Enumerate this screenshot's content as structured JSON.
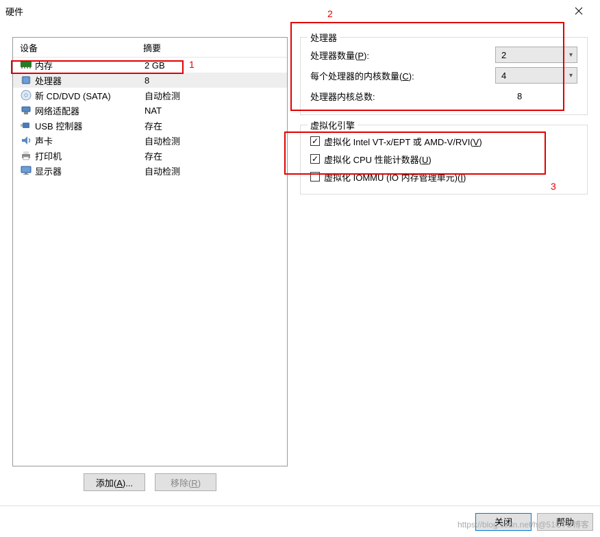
{
  "title": "硬件",
  "columns": {
    "device": "设备",
    "summary": "摘要"
  },
  "devices": [
    {
      "icon": "memory-icon",
      "name": "内存",
      "summary": "2 GB"
    },
    {
      "icon": "cpu-icon",
      "name": "处理器",
      "summary": "8",
      "selected": true
    },
    {
      "icon": "disc-icon",
      "name": "新 CD/DVD (SATA)",
      "summary": "自动检测"
    },
    {
      "icon": "network-icon",
      "name": "网络适配器",
      "summary": "NAT"
    },
    {
      "icon": "usb-icon",
      "name": "USB 控制器",
      "summary": "存在"
    },
    {
      "icon": "sound-icon",
      "name": "声卡",
      "summary": "自动检测"
    },
    {
      "icon": "printer-icon",
      "name": "打印机",
      "summary": "存在"
    },
    {
      "icon": "monitor-icon",
      "name": "显示器",
      "summary": "自动检测"
    }
  ],
  "buttons": {
    "add": "添加(A)...",
    "remove": "移除(R)",
    "close": "关闭",
    "help": "帮助"
  },
  "processor_group": {
    "title": "处理器",
    "count_label_pre": "处理器数量(",
    "count_key": "P",
    "count_label_post": "):",
    "count_value": "2",
    "cores_label_pre": "每个处理器的内核数量(",
    "cores_key": "C",
    "cores_label_post": "):",
    "cores_value": "4",
    "total_label": "处理器内核总数:",
    "total_value": "8"
  },
  "virt_group": {
    "title": "虚拟化引擎",
    "vt_label_pre": "虚拟化 Intel VT-x/EPT 或 AMD-V/RVI(",
    "vt_key": "V",
    "vt_label_post": ")",
    "vt_checked": true,
    "perf_label_pre": "虚拟化 CPU 性能计数器(",
    "perf_key": "U",
    "perf_label_post": ")",
    "perf_checked": true,
    "iommu_label_pre": "虚拟化 IOMMU (IO 内存管理单元)(",
    "iommu_key": "I",
    "iommu_label_post": ")",
    "iommu_checked": false
  },
  "annotations": {
    "a1": "1",
    "a2": "2",
    "a3": "3"
  },
  "watermark": "https://blog.csdn.net/h@51CTO博客"
}
